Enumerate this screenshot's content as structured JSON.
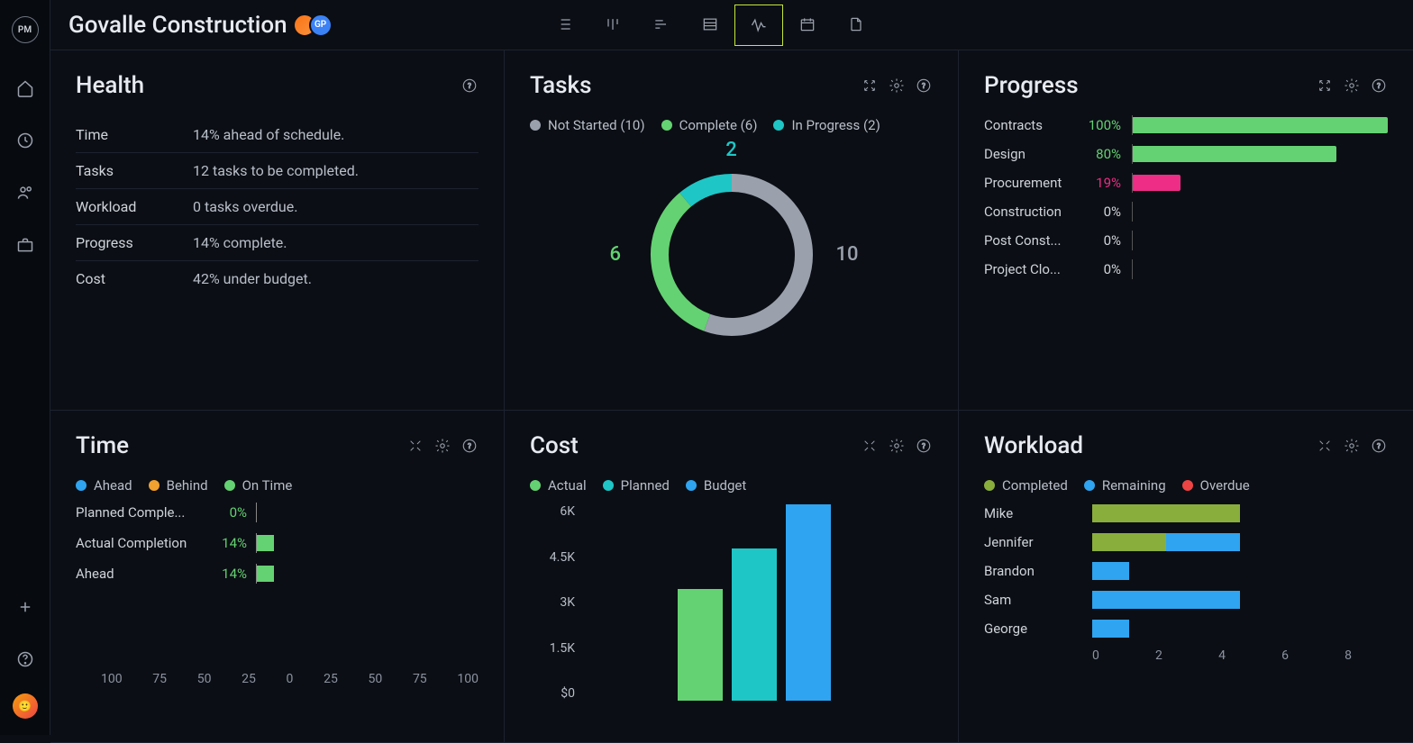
{
  "project": {
    "title": "Govalle Construction",
    "avatars": [
      "",
      "GP"
    ]
  },
  "sidebarIcons": [
    "home",
    "clock",
    "people",
    "briefcase"
  ],
  "viewTabs": [
    "list",
    "bar-vert",
    "gantt",
    "table",
    "pulse",
    "calendar",
    "file"
  ],
  "activeViewTab": 4,
  "panels": {
    "health": {
      "title": "Health",
      "rows": [
        {
          "label": "Time",
          "value": "14% ahead of schedule."
        },
        {
          "label": "Tasks",
          "value": "12 tasks to be completed."
        },
        {
          "label": "Workload",
          "value": "0 tasks overdue."
        },
        {
          "label": "Progress",
          "value": "14% complete."
        },
        {
          "label": "Cost",
          "value": "42% under budget."
        }
      ]
    },
    "tasks": {
      "title": "Tasks",
      "legend": [
        {
          "label": "Not Started",
          "count": 10,
          "color": "#9aa1ad"
        },
        {
          "label": "Complete",
          "count": 6,
          "color": "#64d272"
        },
        {
          "label": "In Progress",
          "count": 2,
          "color": "#1fc6c6"
        }
      ],
      "chart_data": {
        "type": "pie",
        "title": "Tasks",
        "series": [
          {
            "name": "Not Started",
            "value": 10
          },
          {
            "name": "Complete",
            "value": 6
          },
          {
            "name": "In Progress",
            "value": 2
          }
        ],
        "labels": {
          "top": "2",
          "left": "6",
          "right": "10"
        }
      }
    },
    "progress": {
      "title": "Progress",
      "chart_data": {
        "type": "bar",
        "orientation": "horizontal",
        "xlabel": "",
        "ylabel": "",
        "xlim": [
          0,
          100
        ],
        "categories": [
          "Contracts",
          "Design",
          "Procurement",
          "Construction",
          "Post Const...",
          "Project Clo..."
        ],
        "values": [
          100,
          80,
          19,
          0,
          0,
          0
        ],
        "colors": [
          "#64d272",
          "#64d272",
          "#ed2d86",
          "#64d272",
          "#64d272",
          "#64d272"
        ],
        "pctColors": [
          "#64d272",
          "#64d272",
          "#ed2d86",
          "#d1d5db",
          "#d1d5db",
          "#d1d5db"
        ]
      }
    },
    "time": {
      "title": "Time",
      "legend": [
        {
          "label": "Ahead",
          "color": "#2fa4f0"
        },
        {
          "label": "Behind",
          "color": "#f0a12f"
        },
        {
          "label": "On Time",
          "color": "#64d272"
        }
      ],
      "chart_data": {
        "type": "bar",
        "orientation": "horizontal-diverging",
        "ticks": [
          100,
          75,
          50,
          25,
          0,
          25,
          50,
          75,
          100
        ],
        "categories": [
          "Planned Comple...",
          "Actual Completion",
          "Ahead"
        ],
        "values": [
          0,
          14,
          14
        ]
      }
    },
    "cost": {
      "title": "Cost",
      "legend": [
        {
          "label": "Actual",
          "color": "#64d272"
        },
        {
          "label": "Planned",
          "color": "#1fc6c6"
        },
        {
          "label": "Budget",
          "color": "#2fa4f0"
        }
      ],
      "chart_data": {
        "type": "bar",
        "yticks": [
          "6K",
          "4.5K",
          "3K",
          "1.5K",
          "$0"
        ],
        "ylim": [
          0,
          6000
        ],
        "categories": [
          "Actual",
          "Planned",
          "Budget"
        ],
        "values": [
          3400,
          4650,
          6000
        ],
        "colors": [
          "#64d272",
          "#1fc6c6",
          "#2fa4f0"
        ]
      }
    },
    "workload": {
      "title": "Workload",
      "legend": [
        {
          "label": "Completed",
          "color": "#8aae3c"
        },
        {
          "label": "Remaining",
          "color": "#2fa4f0"
        },
        {
          "label": "Overdue",
          "color": "#ef4444"
        }
      ],
      "chart_data": {
        "type": "bar",
        "orientation": "horizontal-stacked",
        "xlim": [
          0,
          8
        ],
        "xticks": [
          0,
          2,
          4,
          6,
          8
        ],
        "categories": [
          "Mike",
          "Jennifer",
          "Brandon",
          "Sam",
          "George"
        ],
        "series": [
          {
            "name": "Completed",
            "values": [
              4,
              2,
              0,
              0,
              0
            ]
          },
          {
            "name": "Remaining",
            "values": [
              0,
              2,
              1,
              4,
              1
            ]
          },
          {
            "name": "Overdue",
            "values": [
              0,
              0,
              0,
              0,
              0
            ]
          }
        ]
      }
    }
  }
}
